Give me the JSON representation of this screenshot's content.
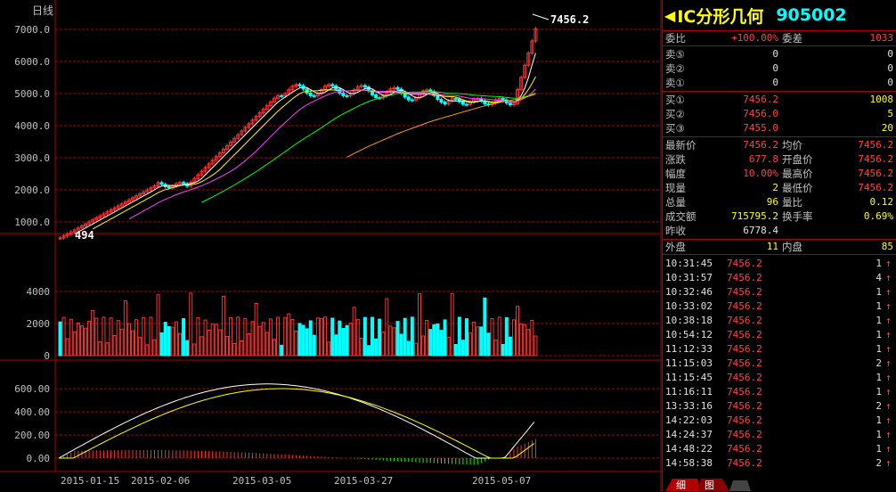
{
  "chart": {
    "period_label": "日线",
    "price_axis": [
      "7000.0",
      "6000.0",
      "5000.0",
      "4000.0",
      "3000.0",
      "2000.0",
      "1000.0"
    ],
    "high_label": "7456.2",
    "low_label": "494",
    "volume_axis": [
      "4000",
      "2000",
      "0"
    ],
    "macd_axis": [
      "600.00",
      "400.00",
      "200.00",
      "0.00"
    ],
    "dates": [
      "2015-01-15",
      "2015-02-06",
      "2015-03-05",
      "2015-03-27",
      "2015-05-07"
    ],
    "colors": {
      "up": "#ff3030",
      "down": "#00ffff",
      "ma5": "#ffffff",
      "ma10": "#ffff00",
      "ma20": "#ff40ff",
      "ma60": "#00ff00",
      "ma120": "#ff9900",
      "grid": "#b00000"
    }
  },
  "quote": {
    "name": "IC分形几何",
    "code": "905002",
    "weibi_label": "委比",
    "weibi_value": "+100.00%",
    "weicha_label": "委差",
    "weicha_value": "1033",
    "sells": [
      {
        "label": "卖⑤",
        "price": "0",
        "vol": "0"
      },
      {
        "label": "卖②",
        "price": "0",
        "vol": "0"
      },
      {
        "label": "卖①",
        "price": "0",
        "vol": "0"
      }
    ],
    "buys": [
      {
        "label": "买①",
        "price": "7456.2",
        "vol": "1008"
      },
      {
        "label": "买②",
        "price": "7456.0",
        "vol": "5"
      },
      {
        "label": "买③",
        "price": "7455.0",
        "vol": "20"
      }
    ],
    "stats": [
      {
        "l1": "最新价",
        "v1": "7456.2",
        "l2": "均价",
        "v2": "7456.2"
      },
      {
        "l1": "涨跌",
        "v1": "677.8",
        "l2": "开盘价",
        "v2": "7456.2"
      },
      {
        "l1": "幅度",
        "v1": "10.00%",
        "l2": "最高价",
        "v2": "7456.2"
      },
      {
        "l1": "现量",
        "v1": "2",
        "l2": "最低价",
        "v2": "7456.2"
      },
      {
        "l1": "总量",
        "v1": "96",
        "l2": "量比",
        "v2": "0.12"
      },
      {
        "l1": "成交额",
        "v1": "715795.2",
        "l2": "换手率",
        "v2": "0.69%"
      }
    ],
    "zuoshou_label": "昨收",
    "zuoshou_value": "6778.4",
    "waipan_label": "外盘",
    "waipan_value": "11",
    "neipan_label": "内盘",
    "neipan_value": "85",
    "ticks": [
      {
        "time": "10:31:45",
        "price": "7456.2",
        "vol": "1"
      },
      {
        "time": "10:31:57",
        "price": "7456.2",
        "vol": "4"
      },
      {
        "time": "10:32:46",
        "price": "7456.2",
        "vol": "1"
      },
      {
        "time": "10:33:02",
        "price": "7456.2",
        "vol": "1"
      },
      {
        "time": "10:38:18",
        "price": "7456.2",
        "vol": "1"
      },
      {
        "time": "10:54:12",
        "price": "7456.2",
        "vol": "1"
      },
      {
        "time": "11:12:33",
        "price": "7456.2",
        "vol": "1"
      },
      {
        "time": "11:15:03",
        "price": "7456.2",
        "vol": "2"
      },
      {
        "time": "11:15:45",
        "price": "7456.2",
        "vol": "1"
      },
      {
        "time": "11:16:11",
        "price": "7456.2",
        "vol": "1"
      },
      {
        "time": "13:33:16",
        "price": "7456.2",
        "vol": "2"
      },
      {
        "time": "14:22:03",
        "price": "7456.2",
        "vol": "1"
      },
      {
        "time": "14:24:37",
        "price": "7456.2",
        "vol": "1"
      },
      {
        "time": "14:48:22",
        "price": "7456.2",
        "vol": "1"
      },
      {
        "time": "14:58:38",
        "price": "7456.2",
        "vol": "2"
      }
    ],
    "tick_arrow": "↑"
  },
  "tabs": {
    "detail": "细",
    "chart": "图"
  }
}
